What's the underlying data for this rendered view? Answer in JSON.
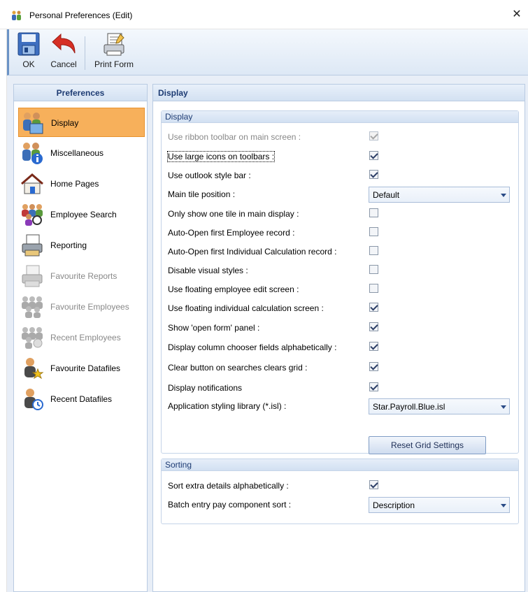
{
  "window": {
    "title": "Personal Preferences (Edit)",
    "close_glyph": "✕"
  },
  "toolbar": {
    "buttons": [
      {
        "label": "OK",
        "icon": "floppy-disk-icon"
      },
      {
        "label": "Cancel",
        "icon": "undo-arrow-icon"
      },
      {
        "label": "Print Form",
        "icon": "print-form-icon"
      }
    ]
  },
  "sidebar": {
    "header": "Preferences",
    "items": [
      {
        "label": "Display",
        "icon": "people-display-icon",
        "selected": true,
        "enabled": true
      },
      {
        "label": "Miscellaneous",
        "icon": "people-info-icon",
        "enabled": true
      },
      {
        "label": "Home Pages",
        "icon": "house-icon",
        "enabled": true
      },
      {
        "label": "Employee Search",
        "icon": "employee-search-icon",
        "enabled": true
      },
      {
        "label": "Reporting",
        "icon": "printer-report-icon",
        "enabled": true
      },
      {
        "label": "Favourite Reports",
        "icon": "favourite-reports-icon",
        "enabled": false
      },
      {
        "label": "Favourite Employees",
        "icon": "favourite-employees-icon",
        "enabled": false
      },
      {
        "label": "Recent Employees",
        "icon": "recent-employees-icon",
        "enabled": false
      },
      {
        "label": "Favourite Datafiles",
        "icon": "favourite-datafiles-icon",
        "enabled": true
      },
      {
        "label": "Recent Datafiles",
        "icon": "recent-datafiles-icon",
        "enabled": true
      }
    ]
  },
  "main": {
    "header": "Display",
    "display_group": {
      "title": "Display",
      "rows": [
        {
          "label": "Use ribbon toolbar on main screen :",
          "type": "checkbox",
          "checked": true,
          "disabled": true
        },
        {
          "label": "Use large icons on toolbars :",
          "type": "checkbox",
          "checked": true,
          "focused": true
        },
        {
          "label": "Use outlook style bar :",
          "type": "checkbox",
          "checked": true
        },
        {
          "label": "Main tile position :",
          "type": "select",
          "value": "Default"
        },
        {
          "label": "Only show one tile in main display :",
          "type": "checkbox",
          "checked": false
        },
        {
          "label": "Auto-Open first Employee record :",
          "type": "checkbox",
          "checked": false
        },
        {
          "label": "Auto-Open first Individual Calculation record :",
          "type": "checkbox",
          "checked": false
        },
        {
          "label": "Disable visual styles :",
          "type": "checkbox",
          "checked": false
        },
        {
          "label": "Use floating employee edit screen :",
          "type": "checkbox",
          "checked": false
        },
        {
          "label": "Use floating individual calculation screen :",
          "type": "checkbox",
          "checked": true
        },
        {
          "label": "Show 'open form' panel :",
          "type": "checkbox",
          "checked": true
        },
        {
          "label": "Display column chooser fields alphabetically :",
          "type": "checkbox",
          "checked": true
        },
        {
          "label": "Clear button on searches clears grid :",
          "type": "checkbox",
          "checked": true
        },
        {
          "label": "Display notifications",
          "type": "checkbox",
          "checked": true
        },
        {
          "label": "Application styling library (*.isl) :",
          "type": "select",
          "value": "Star.Payroll.Blue.isl"
        }
      ],
      "reset_button": "Reset Grid Settings"
    },
    "sorting_group": {
      "title": "Sorting",
      "rows": [
        {
          "label": "Sort extra details alphabetically :",
          "type": "checkbox",
          "checked": true
        },
        {
          "label": "Batch entry pay component sort :",
          "type": "select",
          "value": "Description"
        }
      ]
    }
  }
}
